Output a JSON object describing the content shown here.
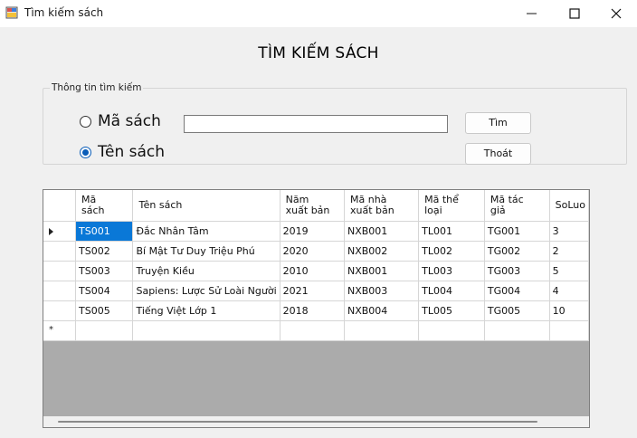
{
  "window": {
    "title": "Tìm kiếm sách",
    "minimize_icon": "minimize-icon",
    "maximize_icon": "maximize-icon",
    "close_icon": "close-icon"
  },
  "form": {
    "heading": "TÌM KIẾM SÁCH"
  },
  "search_group": {
    "legend": "Thông tin tìm kiếm",
    "radio_ma_sach": {
      "label": "Mã sách",
      "checked": false
    },
    "radio_ten_sach": {
      "label": "Tên sách",
      "checked": true
    },
    "search_value": "",
    "find_button": "Tìm",
    "exit_button": "Thoát"
  },
  "grid": {
    "columns": [
      [
        "Mã",
        "sách"
      ],
      [
        "Tên sách",
        ""
      ],
      [
        "Năm",
        "xuất bản"
      ],
      [
        "Mã nhà",
        "xuất bản"
      ],
      [
        "Mã thể",
        "loại"
      ],
      [
        "Mã tác",
        "giả"
      ],
      [
        "SoLuo",
        ""
      ]
    ],
    "rows": [
      [
        "TS001",
        "Đắc Nhân Tâm",
        "2019",
        "NXB001",
        "TL001",
        "TG001",
        "3"
      ],
      [
        "TS002",
        "Bí Mật Tư Duy Triệu Phú",
        "2020",
        "NXB002",
        "TL002",
        "TG002",
        "2"
      ],
      [
        "TS003",
        "Truyện Kiều",
        "2010",
        "NXB001",
        "TL003",
        "TG003",
        "5"
      ],
      [
        "TS004",
        "Sapiens: Lược Sử Loài Người",
        "2021",
        "NXB003",
        "TL004",
        "TG004",
        "4"
      ],
      [
        "TS005",
        "Tiếng Việt Lớp 1",
        "2018",
        "NXB004",
        "TL005",
        "TG005",
        "10"
      ]
    ],
    "current_row_icon": "row-pointer-icon",
    "new_row_marker": "*"
  },
  "colors": {
    "selection": "#0a78d7",
    "radio_checked": "#0a5db8",
    "grid_background": "#ababab"
  }
}
